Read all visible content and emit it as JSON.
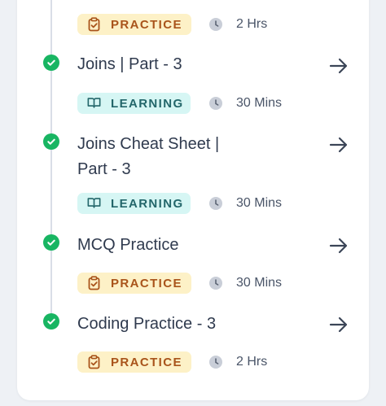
{
  "colors": {
    "check_green": "#18b562",
    "practice_bg": "#fdf1c7",
    "practice_text": "#a9541b",
    "learning_bg": "#d6f6f4",
    "learning_text": "#23666a"
  },
  "top_item": {
    "badge": "PRACTICE",
    "badge_icon": "clipboard-icon",
    "duration": "2 Hrs"
  },
  "items": [
    {
      "title_lines": [
        "Joins | Part - 3"
      ],
      "status": "completed",
      "badge": "LEARNING",
      "badge_icon": "book-icon",
      "duration": "30 Mins"
    },
    {
      "title_lines": [
        "Joins Cheat Sheet |",
        "Part - 3"
      ],
      "status": "completed",
      "badge": "LEARNING",
      "badge_icon": "book-icon",
      "duration": "30 Mins"
    },
    {
      "title_lines": [
        "MCQ Practice"
      ],
      "status": "completed",
      "badge": "PRACTICE",
      "badge_icon": "clipboard-icon",
      "duration": "30 Mins"
    },
    {
      "title_lines": [
        "Coding Practice - 3"
      ],
      "status": "completed",
      "badge": "PRACTICE",
      "badge_icon": "clipboard-icon",
      "duration": "2 Hrs"
    }
  ]
}
